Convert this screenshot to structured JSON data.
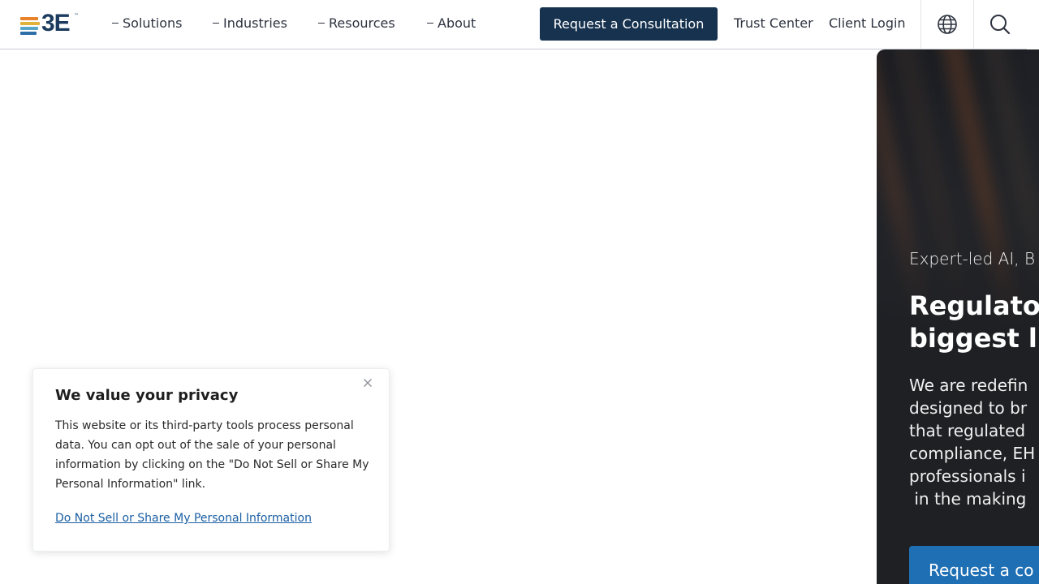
{
  "brand": {
    "logo_text": "3E",
    "trademark": "™",
    "colors": {
      "bar1": "#e8832a",
      "bar2": "#e0b23a",
      "bar3": "#5aa6c9",
      "bar4": "#2e6fa8",
      "text": "#1a3a5e"
    }
  },
  "nav": {
    "items": [
      {
        "label": "Solutions"
      },
      {
        "label": "Industries"
      },
      {
        "label": "Resources"
      },
      {
        "label": "About"
      }
    ],
    "cta_label": "Request a Consultation",
    "trust_center": "Trust Center",
    "client_login": "Client Login",
    "icons": [
      "globe-icon",
      "search-icon"
    ]
  },
  "hero": {
    "eyebrow": "Expert-led AI, B",
    "title_lines": [
      "Regulato",
      "biggest l"
    ],
    "body_lines": [
      "We are redefin",
      "designed to br",
      "that regulated",
      "compliance, EH",
      "professionals i",
      " in the making"
    ],
    "button_label": "Request a co"
  },
  "privacy": {
    "title": "We value your privacy",
    "body": "This website or its third-party tools process personal data. You can opt out of the sale of your personal information by clicking on the \"Do Not Sell or Share My Personal Information\" link.",
    "link": "Do Not Sell or Share My Personal Information",
    "close_icon": "close-icon"
  },
  "colors": {
    "accent_dark": "#17324f",
    "hero_button": "#1f6fb4",
    "link": "#1a5fa3"
  }
}
